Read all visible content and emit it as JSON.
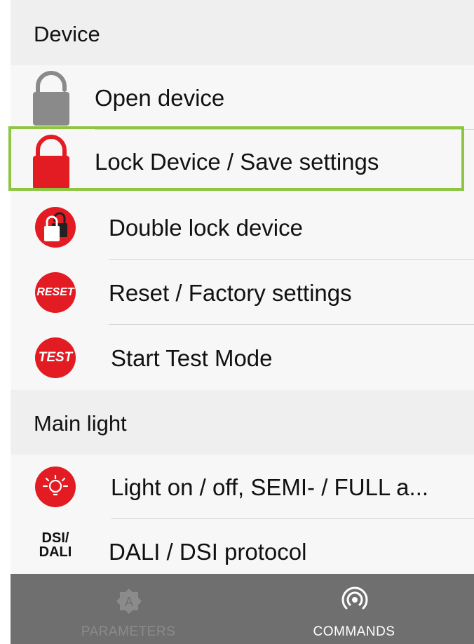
{
  "sections": {
    "device": {
      "title": "Device"
    },
    "main_light": {
      "title": "Main light"
    }
  },
  "items": {
    "open_device": {
      "label": "Open device",
      "icon": "unlocked-padlock-icon",
      "icon_color": "#8a8a8a"
    },
    "lock_device": {
      "label": "Lock Device / Save settings",
      "icon": "locked-padlock-icon",
      "icon_color": "#e31b23",
      "selected": true
    },
    "double_lock": {
      "label": "Double lock device",
      "icon": "double-lock-icon"
    },
    "reset": {
      "label": "Reset / Factory settings",
      "icon": "reset-icon",
      "icon_text": "RESET"
    },
    "test": {
      "label": "Start Test Mode",
      "icon": "test-icon",
      "icon_text": "TEST"
    },
    "light": {
      "label": "Light on / off, SEMI- / FULL a...",
      "icon": "light-bulb-icon"
    },
    "dali": {
      "label": "DALI / DSI protocol",
      "icon": "dsi-dali-icon",
      "icon_line1": "DSI/",
      "icon_line2": "DALI"
    }
  },
  "tabbar": {
    "parameters": {
      "label": "PARAMETERS",
      "icon": "parameters-icon",
      "icon_text": "A",
      "active": false
    },
    "commands": {
      "label": "COMMANDS",
      "icon": "broadcast-icon",
      "active": true
    }
  },
  "colors": {
    "accent_red": "#e31b23",
    "selection_outline": "#8ec641",
    "tabbar_bg": "#6f6f6f",
    "tab_inactive": "#8b8b8b",
    "tab_active": "#ffffff"
  }
}
